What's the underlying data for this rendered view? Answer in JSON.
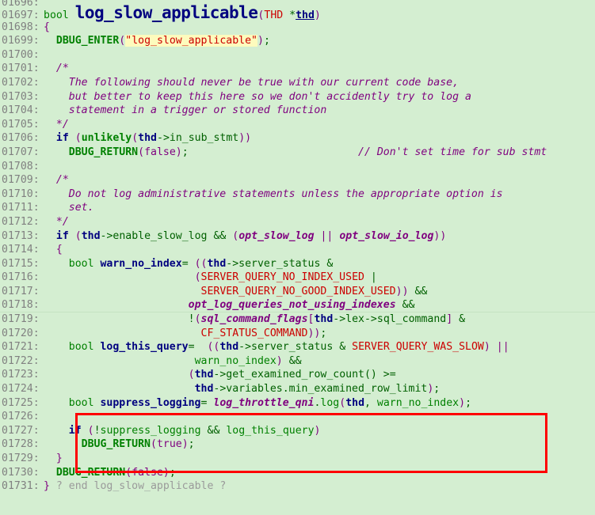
{
  "viewer": {
    "kind": "source-code-viewer",
    "language": "C++",
    "background_color": "#d4eed1",
    "lineno_color": "#808080",
    "first_visible_line": "01696",
    "last_visible_line": "01731"
  },
  "annotation": {
    "type": "rectangle-highlight",
    "color": "#ff0000",
    "covers_lines": [
      "01725",
      "01726",
      "01727",
      "01728"
    ]
  },
  "lines": [
    {
      "no": "01696",
      "clipped": true,
      "tokens": []
    },
    {
      "no": "01697",
      "tokens": [
        {
          "t": "typ",
          "s": "bool "
        },
        {
          "t": "fname",
          "s": "log_slow_applicable"
        },
        {
          "t": "punc",
          "s": "("
        },
        {
          "t": "const",
          "s": "THD"
        },
        {
          "t": "plain",
          "s": " *"
        },
        {
          "t": "varu",
          "s": "thd"
        },
        {
          "t": "punc",
          "s": ")"
        }
      ]
    },
    {
      "no": "01698",
      "tokens": [
        {
          "t": "punc",
          "s": "{"
        }
      ]
    },
    {
      "no": "01699",
      "tokens": [
        {
          "t": "plain",
          "s": "  "
        },
        {
          "t": "fn",
          "s": "DBUG_ENTER"
        },
        {
          "t": "punc",
          "s": "("
        },
        {
          "t": "str",
          "s": "\"log_slow_applicable\""
        },
        {
          "t": "punc",
          "s": ")"
        },
        {
          "t": "plain",
          "s": ";"
        }
      ]
    },
    {
      "no": "01700",
      "tokens": []
    },
    {
      "no": "01701",
      "tokens": [
        {
          "t": "cmt",
          "s": "  /*"
        }
      ]
    },
    {
      "no": "01702",
      "tokens": [
        {
          "t": "cmt",
          "s": "    The following should never be true with our current code base,"
        }
      ]
    },
    {
      "no": "01703",
      "tokens": [
        {
          "t": "cmt",
          "s": "    but better to keep this here so we don't accidently try to log a"
        }
      ]
    },
    {
      "no": "01704",
      "tokens": [
        {
          "t": "cmt",
          "s": "    statement in a trigger or stored function"
        }
      ]
    },
    {
      "no": "01705",
      "tokens": [
        {
          "t": "cmt",
          "s": "  */"
        }
      ]
    },
    {
      "no": "01706",
      "tokens": [
        {
          "t": "plain",
          "s": "  "
        },
        {
          "t": "kw",
          "s": "if"
        },
        {
          "t": "plain",
          "s": " "
        },
        {
          "t": "punc",
          "s": "("
        },
        {
          "t": "fn",
          "s": "unlikely"
        },
        {
          "t": "punc",
          "s": "("
        },
        {
          "t": "var",
          "s": "thd"
        },
        {
          "t": "plain",
          "s": "->in_sub_stmt"
        },
        {
          "t": "punc",
          "s": "))"
        }
      ]
    },
    {
      "no": "01707",
      "tokens": [
        {
          "t": "plain",
          "s": "    "
        },
        {
          "t": "fn",
          "s": "DBUG_RETURN"
        },
        {
          "t": "punc",
          "s": "("
        },
        {
          "t": "lit",
          "s": "false"
        },
        {
          "t": "punc",
          "s": ")"
        },
        {
          "t": "plain",
          "s": ";                           "
        },
        {
          "t": "cmt",
          "s": "// Don't set time for sub stmt"
        }
      ]
    },
    {
      "no": "01708",
      "tokens": []
    },
    {
      "no": "01709",
      "tokens": [
        {
          "t": "cmt",
          "s": "  /*"
        }
      ]
    },
    {
      "no": "01710",
      "tokens": [
        {
          "t": "cmt",
          "s": "    Do not log administrative statements unless the appropriate option is"
        }
      ]
    },
    {
      "no": "01711",
      "tokens": [
        {
          "t": "cmt",
          "s": "    set."
        }
      ]
    },
    {
      "no": "01712",
      "tokens": [
        {
          "t": "cmt",
          "s": "  */"
        }
      ]
    },
    {
      "no": "01713",
      "tokens": [
        {
          "t": "plain",
          "s": "  "
        },
        {
          "t": "kw",
          "s": "if"
        },
        {
          "t": "plain",
          "s": " "
        },
        {
          "t": "punc",
          "s": "("
        },
        {
          "t": "var",
          "s": "thd"
        },
        {
          "t": "plain",
          "s": "->enable_slow_log "
        },
        {
          "t": "op",
          "s": "&&"
        },
        {
          "t": "plain",
          "s": " "
        },
        {
          "t": "punc",
          "s": "("
        },
        {
          "t": "gvar",
          "s": "opt_slow_log"
        },
        {
          "t": "plain",
          "s": " "
        },
        {
          "t": "punc",
          "s": "||"
        },
        {
          "t": "plain",
          "s": " "
        },
        {
          "t": "gvar",
          "s": "opt_slow_io_log"
        },
        {
          "t": "punc",
          "s": "))"
        }
      ]
    },
    {
      "no": "01714",
      "tokens": [
        {
          "t": "punc",
          "s": "  {"
        }
      ]
    },
    {
      "no": "01715",
      "tokens": [
        {
          "t": "plain",
          "s": "    "
        },
        {
          "t": "typ",
          "s": "bool "
        },
        {
          "t": "var",
          "s": "warn_no_index"
        },
        {
          "t": "plain",
          "s": "= "
        },
        {
          "t": "punc",
          "s": "(("
        },
        {
          "t": "var",
          "s": "thd"
        },
        {
          "t": "plain",
          "s": "->server_status "
        },
        {
          "t": "op",
          "s": "&"
        }
      ]
    },
    {
      "no": "01716",
      "tokens": [
        {
          "t": "plain",
          "s": "                        "
        },
        {
          "t": "punc",
          "s": "("
        },
        {
          "t": "const",
          "s": "SERVER_QUERY_NO_INDEX_USED"
        },
        {
          "t": "plain",
          "s": " "
        },
        {
          "t": "op",
          "s": "|"
        }
      ]
    },
    {
      "no": "01717",
      "tokens": [
        {
          "t": "plain",
          "s": "                         "
        },
        {
          "t": "const",
          "s": "SERVER_QUERY_NO_GOOD_INDEX_USED"
        },
        {
          "t": "punc",
          "s": "))"
        },
        {
          "t": "plain",
          "s": " "
        },
        {
          "t": "op",
          "s": "&&"
        }
      ]
    },
    {
      "no": "01718",
      "sep": true,
      "tokens": [
        {
          "t": "plain",
          "s": "                       "
        },
        {
          "t": "gvar",
          "s": "opt_log_queries_not_using_indexes"
        },
        {
          "t": "plain",
          "s": " "
        },
        {
          "t": "op",
          "s": "&&"
        }
      ]
    },
    {
      "no": "01719",
      "tokens": [
        {
          "t": "plain",
          "s": "                       "
        },
        {
          "t": "op",
          "s": "!"
        },
        {
          "t": "punc",
          "s": "("
        },
        {
          "t": "gvar",
          "s": "sql_command_flags"
        },
        {
          "t": "punc",
          "s": "["
        },
        {
          "t": "var",
          "s": "thd"
        },
        {
          "t": "plain",
          "s": "->lex->sql_command"
        },
        {
          "t": "punc",
          "s": "]"
        },
        {
          "t": "plain",
          "s": " "
        },
        {
          "t": "op",
          "s": "&"
        }
      ]
    },
    {
      "no": "01720",
      "tokens": [
        {
          "t": "plain",
          "s": "                         "
        },
        {
          "t": "const",
          "s": "CF_STATUS_COMMAND"
        },
        {
          "t": "punc",
          "s": "))"
        },
        {
          "t": "plain",
          "s": ";"
        }
      ]
    },
    {
      "no": "01721",
      "tokens": [
        {
          "t": "plain",
          "s": "    "
        },
        {
          "t": "typ",
          "s": "bool "
        },
        {
          "t": "var",
          "s": "log_this_query"
        },
        {
          "t": "plain",
          "s": "=  "
        },
        {
          "t": "punc",
          "s": "(("
        },
        {
          "t": "var",
          "s": "thd"
        },
        {
          "t": "plain",
          "s": "->server_status "
        },
        {
          "t": "op",
          "s": "&"
        },
        {
          "t": "plain",
          "s": " "
        },
        {
          "t": "const",
          "s": "SERVER_QUERY_WAS_SLOW"
        },
        {
          "t": "punc",
          "s": ")"
        },
        {
          "t": "plain",
          "s": " "
        },
        {
          "t": "punc",
          "s": "||"
        }
      ]
    },
    {
      "no": "01722",
      "tokens": [
        {
          "t": "plain",
          "s": "                        "
        },
        {
          "t": "memb",
          "s": "warn_no_index"
        },
        {
          "t": "punc",
          "s": ")"
        },
        {
          "t": "plain",
          "s": " "
        },
        {
          "t": "op",
          "s": "&&"
        }
      ]
    },
    {
      "no": "01723",
      "tokens": [
        {
          "t": "plain",
          "s": "                       "
        },
        {
          "t": "punc",
          "s": "("
        },
        {
          "t": "var",
          "s": "thd"
        },
        {
          "t": "plain",
          "s": "->get_examined_row_count() >="
        }
      ]
    },
    {
      "no": "01724",
      "tokens": [
        {
          "t": "plain",
          "s": "                        "
        },
        {
          "t": "var",
          "s": "thd"
        },
        {
          "t": "plain",
          "s": "->variables.min_examined_row_limit"
        },
        {
          "t": "punc",
          "s": ")"
        },
        {
          "t": "plain",
          "s": ";"
        }
      ]
    },
    {
      "no": "01725",
      "tokens": [
        {
          "t": "plain",
          "s": "    "
        },
        {
          "t": "typ",
          "s": "bool "
        },
        {
          "t": "var",
          "s": "suppress_logging"
        },
        {
          "t": "plain",
          "s": "= "
        },
        {
          "t": "gvar",
          "s": "log_throttle_qni"
        },
        {
          "t": "plain",
          "s": "."
        },
        {
          "t": "memb",
          "s": "log"
        },
        {
          "t": "punc",
          "s": "("
        },
        {
          "t": "var",
          "s": "thd"
        },
        {
          "t": "plain",
          "s": ", "
        },
        {
          "t": "memb",
          "s": "warn_no_index"
        },
        {
          "t": "punc",
          "s": ")"
        },
        {
          "t": "plain",
          "s": ";"
        }
      ]
    },
    {
      "no": "01726",
      "tokens": []
    },
    {
      "no": "01727",
      "tokens": [
        {
          "t": "plain",
          "s": "    "
        },
        {
          "t": "kw",
          "s": "if"
        },
        {
          "t": "plain",
          "s": " "
        },
        {
          "t": "punc",
          "s": "("
        },
        {
          "t": "op",
          "s": "!"
        },
        {
          "t": "memb",
          "s": "suppress_logging"
        },
        {
          "t": "plain",
          "s": " "
        },
        {
          "t": "op",
          "s": "&&"
        },
        {
          "t": "plain",
          "s": " "
        },
        {
          "t": "memb",
          "s": "log_this_query"
        },
        {
          "t": "punc",
          "s": ")"
        }
      ]
    },
    {
      "no": "01728",
      "tokens": [
        {
          "t": "plain",
          "s": "      "
        },
        {
          "t": "fn",
          "s": "DBUG_RETURN"
        },
        {
          "t": "punc",
          "s": "("
        },
        {
          "t": "lit",
          "s": "true"
        },
        {
          "t": "punc",
          "s": ")"
        },
        {
          "t": "plain",
          "s": ";"
        }
      ]
    },
    {
      "no": "01729",
      "tokens": [
        {
          "t": "punc",
          "s": "  }"
        }
      ]
    },
    {
      "no": "01730",
      "tokens": [
        {
          "t": "plain",
          "s": "  "
        },
        {
          "t": "fn",
          "s": "DBUG_RETURN"
        },
        {
          "t": "punc",
          "s": "("
        },
        {
          "t": "lit",
          "s": "false"
        },
        {
          "t": "punc",
          "s": ")"
        },
        {
          "t": "plain",
          "s": ";"
        }
      ]
    },
    {
      "no": "01731",
      "tokens": [
        {
          "t": "punc",
          "s": "}"
        },
        {
          "t": "gray",
          "s": " ? end log_slow_applicable ?"
        }
      ]
    }
  ]
}
